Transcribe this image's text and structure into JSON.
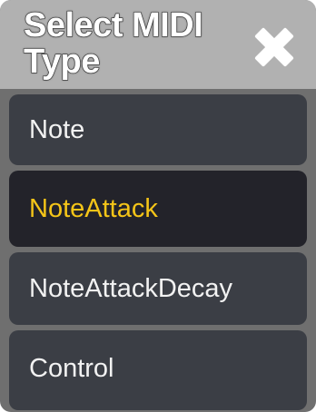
{
  "dialog": {
    "title": "Select MIDI Type",
    "close_icon": "close-icon"
  },
  "options": [
    {
      "label": "Note",
      "selected": false
    },
    {
      "label": "NoteAttack",
      "selected": true
    },
    {
      "label": "NoteAttackDecay",
      "selected": false
    },
    {
      "label": "Control",
      "selected": false
    }
  ],
  "colors": {
    "header_bg": "#b1b1b1",
    "item_bg": "#3b3e45",
    "selected_bg": "#23232a",
    "selected_text": "#f5c518",
    "item_text": "#f2f2f2"
  }
}
